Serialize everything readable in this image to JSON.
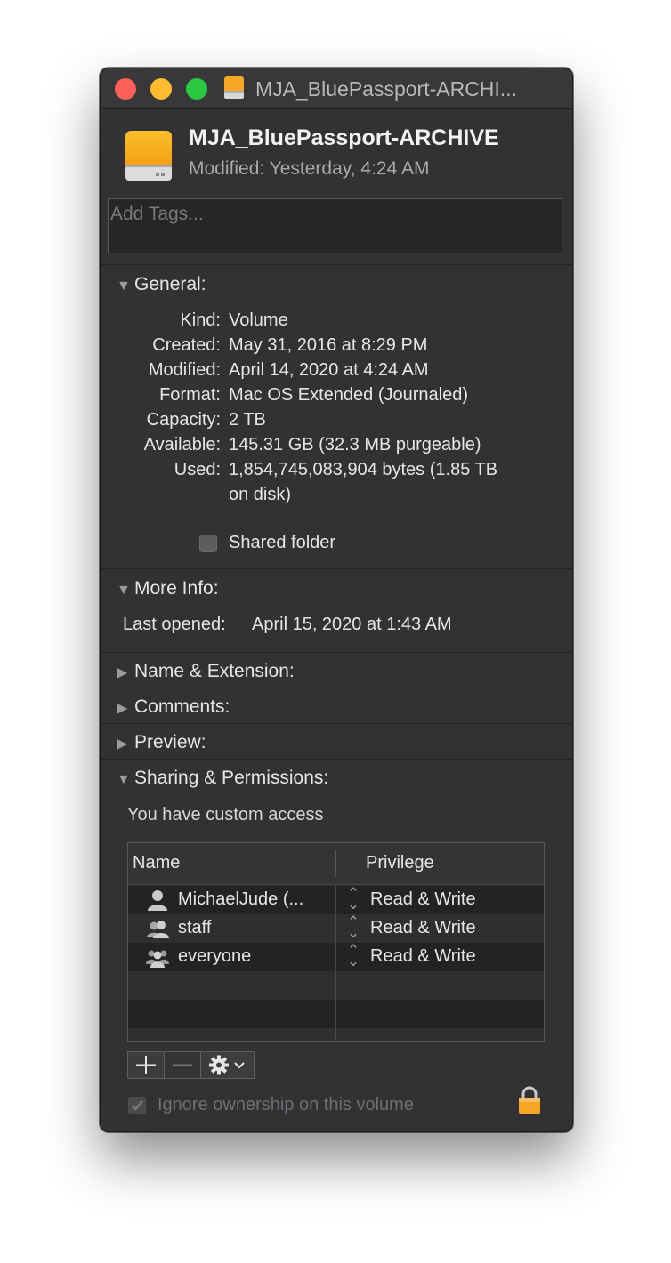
{
  "window": {
    "title": "MJA_BluePassport-ARCHI...",
    "traffic_lights": {
      "close": "#fe5f57",
      "minimize": "#febc2e",
      "zoom": "#28c840"
    }
  },
  "header": {
    "name": "MJA_BluePassport-ARCHIVE",
    "modified": "Modified:  Yesterday, 4:24 AM",
    "icon": "external-drive-icon"
  },
  "tags": {
    "placeholder": "Add Tags..."
  },
  "general": {
    "title": "General:",
    "rows": [
      {
        "label": "Kind:",
        "value": "Volume"
      },
      {
        "label": "Created:",
        "value": "May 31, 2016 at 8:29 PM"
      },
      {
        "label": "Modified:",
        "value": "April 14, 2020 at 4:24 AM"
      },
      {
        "label": "Format:",
        "value": "Mac OS Extended (Journaled)"
      },
      {
        "label": "Capacity:",
        "value": "2 TB"
      },
      {
        "label": "Available:",
        "value": "145.31 GB (32.3 MB purgeable)"
      },
      {
        "label": "Used:",
        "value": "1,854,745,083,904 bytes (1.85 TB",
        "value2": "on disk)"
      }
    ],
    "shared_folder": {
      "label": "Shared folder",
      "checked": false
    }
  },
  "more_info": {
    "title": "More Info:",
    "last_opened_label": "Last opened:",
    "last_opened_value": "April 15, 2020 at 1:43 AM"
  },
  "collapsed_sections": [
    "Name & Extension:",
    "Comments:",
    "Preview:"
  ],
  "sharing": {
    "title": "Sharing & Permissions:",
    "access_note": "You have custom access",
    "columns": [
      "Name",
      "Privilege"
    ],
    "rows": [
      {
        "name": "MichaelJude (...",
        "privilege": "Read & Write",
        "icon": "user-icon"
      },
      {
        "name": "staff",
        "privilege": "Read & Write",
        "icon": "group-icon"
      },
      {
        "name": "everyone",
        "privilege": "Read & Write",
        "icon": "everyone-icon"
      }
    ],
    "buttons": {
      "add": "+",
      "remove": "—",
      "gear": "gear-icon"
    },
    "ignore_ownership": {
      "label": "Ignore ownership on this volume",
      "checked": true,
      "enabled": false
    },
    "lock_icon": "lock-icon"
  },
  "colors": {
    "window_bg": "#323235",
    "accent_drive": "#f5a623",
    "text": "#e6e6e6"
  }
}
